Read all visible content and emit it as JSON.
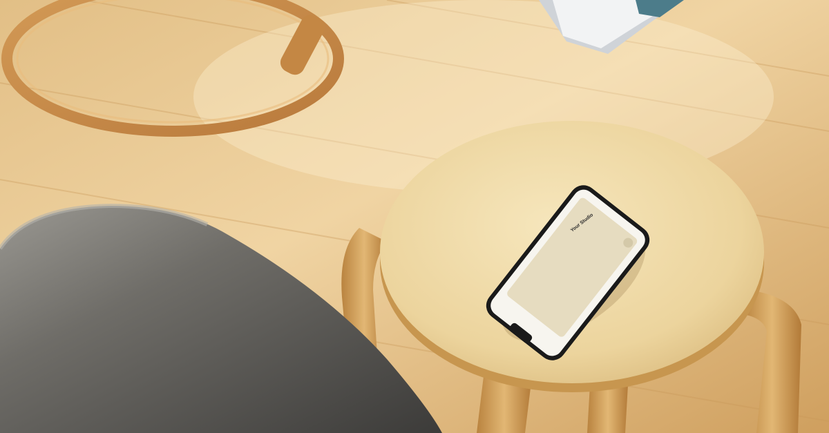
{
  "phone_screen": {
    "title": "Your Studio"
  },
  "colors": {
    "floor": "#d9b27a",
    "stool_top": "#efd9a4",
    "stool_leg": "#c99a55",
    "sofa": "#6e6e6e",
    "phone_frame": "#1a1a1a",
    "screen_bg": "#f7f5ef",
    "screen_panel": "#e6dcc0"
  }
}
